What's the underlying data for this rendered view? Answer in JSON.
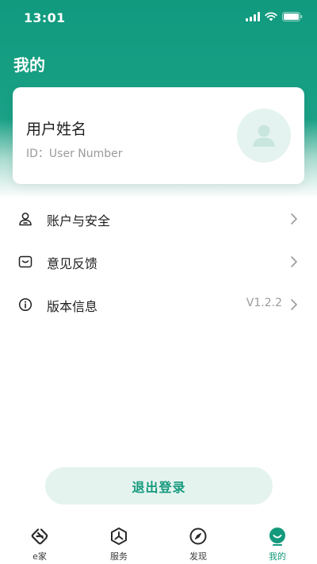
{
  "status_bar": {
    "time": "13:01"
  },
  "header": {
    "title": "我的"
  },
  "profile": {
    "name": "用户姓名",
    "id_text": "ID：User Number"
  },
  "menu": {
    "items": [
      {
        "label": "账户与安全",
        "value": "",
        "icon": "user-lock-icon"
      },
      {
        "label": "意见反馈",
        "value": "",
        "icon": "message-box-icon"
      },
      {
        "label": "版本信息",
        "value": "V1.2.2",
        "icon": "info-icon"
      }
    ]
  },
  "logout": {
    "label": "退出登录"
  },
  "tabbar": {
    "tabs": [
      {
        "label": "e家",
        "icon": "home-e-icon",
        "active": false
      },
      {
        "label": "服务",
        "icon": "service-hex-icon",
        "active": false
      },
      {
        "label": "发现",
        "icon": "compass-icon",
        "active": false
      },
      {
        "label": "我的",
        "icon": "profile-face-icon",
        "active": true
      }
    ]
  },
  "colors": {
    "brand": "#14997c",
    "brand_light": "#e5f3ef",
    "text": "#1f1f1f",
    "muted": "#9a9a9a"
  }
}
